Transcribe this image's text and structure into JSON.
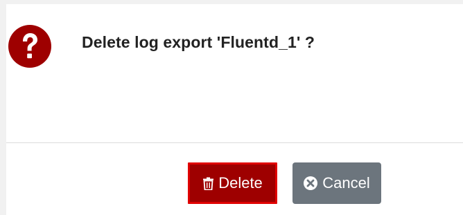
{
  "dialog": {
    "message": "Delete log export 'Fluentd_1' ?",
    "icon": "question-circle-icon"
  },
  "actions": {
    "delete_label": "Delete",
    "delete_icon": "trash-icon",
    "cancel_label": "Cancel",
    "cancel_icon": "close-circle-icon"
  },
  "colors": {
    "question_icon": "#9e0000",
    "delete_button": "#9e0000",
    "delete_border": "#e00000",
    "cancel_button": "#6c757d"
  }
}
